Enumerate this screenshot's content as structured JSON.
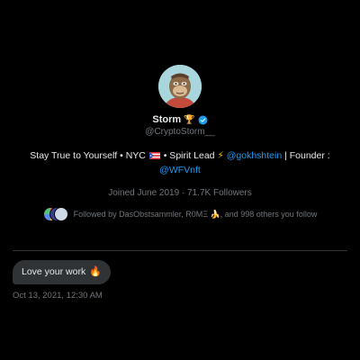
{
  "profile": {
    "name": "Storm",
    "name_badge": "🏆",
    "handle": "@CryptoStorm__",
    "bio": {
      "part1": "Stay True to Yourself • NYC",
      "part2": "• Spirit Lead",
      "bolt": "⚡",
      "mention1": "@gokhshtein",
      "part3": " | Founder :",
      "mention2": "@WFVnft"
    },
    "stats": "Joined June 2019 · 71.7K Followers",
    "followed_by": "Followed by DasObstsammler, R0MΞ 🍌, and 998 others you follow"
  },
  "messages": [
    {
      "text": "Love your work",
      "emoji": "🔥",
      "timestamp": "Oct 13, 2021, 12:30 AM"
    }
  ],
  "colors": {
    "background": "#000000",
    "accent": "#1d9bf0",
    "muted": "#71767b",
    "bubble": "#2f3336"
  },
  "icons": {
    "verified": "verified-badge-icon",
    "flag": "puerto-rico-flag-icon",
    "avatar": "ape-avatar"
  }
}
